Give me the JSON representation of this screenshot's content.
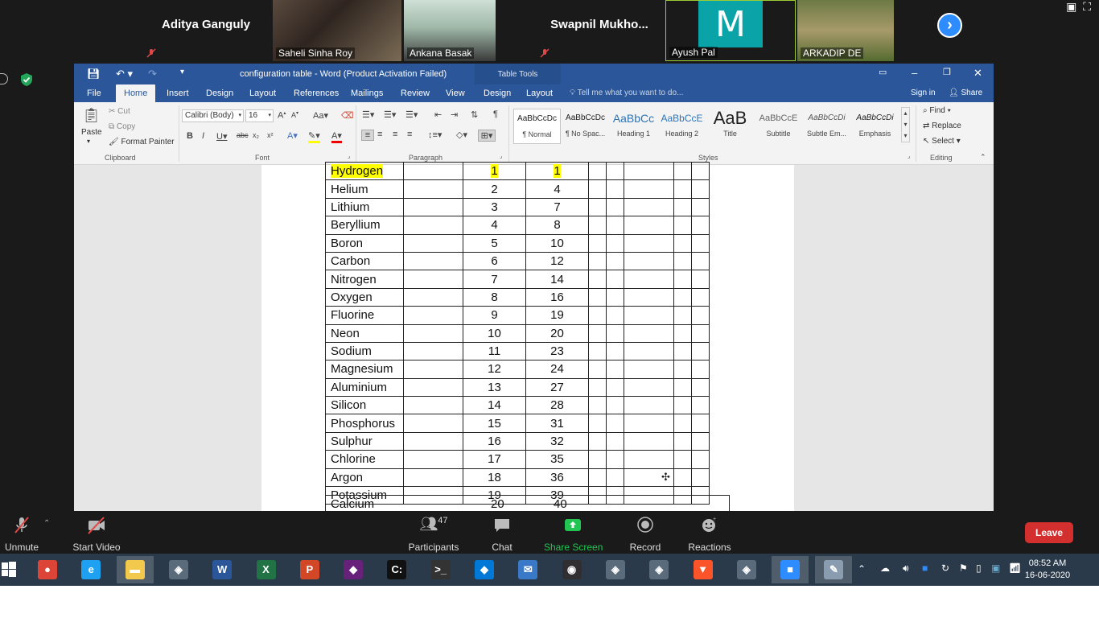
{
  "zoom": {
    "participants": [
      {
        "name": "Aditya Ganguly",
        "muted": true,
        "video": false
      },
      {
        "name": "Saheli Sinha Roy",
        "video": true
      },
      {
        "name": "Ankana Basak",
        "video": true
      },
      {
        "name": "Swapnil  Mukho...",
        "muted": true,
        "video": false
      },
      {
        "name": "Ayush Pal",
        "avatar_letter": "M",
        "video": false
      },
      {
        "name": "ARKADIP DE",
        "video": true
      }
    ],
    "controls": {
      "unmute": "Unmute",
      "start_video": "Start Video",
      "participants": "Participants",
      "participants_count": "47",
      "chat": "Chat",
      "share_screen": "Share Screen",
      "record": "Record",
      "reactions": "Reactions",
      "leave": "Leave"
    }
  },
  "word": {
    "title": "configuration table - Word (Product Activation Failed)",
    "context_tab_group": "Table Tools",
    "tabs": [
      "File",
      "Home",
      "Insert",
      "Design",
      "Layout",
      "References",
      "Mailings",
      "Review",
      "View",
      "Design",
      "Layout"
    ],
    "active_tab": "Home",
    "tell_me": "Tell me what you want to do...",
    "sign_in": "Sign in",
    "share": "Share",
    "ribbon": {
      "clipboard": {
        "paste": "Paste",
        "cut": "Cut",
        "copy": "Copy",
        "format_painter": "Format Painter",
        "label": "Clipboard"
      },
      "font": {
        "family": "Calibri (Body)",
        "size": "16",
        "label": "Font"
      },
      "paragraph": {
        "label": "Paragraph"
      },
      "styles": {
        "items": [
          {
            "preview": "AaBbCcDc",
            "name": "¶ Normal"
          },
          {
            "preview": "AaBbCcDc",
            "name": "¶ No Spac..."
          },
          {
            "preview": "AaBbCc",
            "name": "Heading 1"
          },
          {
            "preview": "AaBbCcE",
            "name": "Heading 2"
          },
          {
            "preview": "AaB",
            "name": "Title"
          },
          {
            "preview": "AaBbCcE",
            "name": "Subtitle"
          },
          {
            "preview": "AaBbCcDi",
            "name": "Subtle Em..."
          },
          {
            "preview": "AaBbCcDi",
            "name": "Emphasis"
          }
        ],
        "label": "Styles"
      },
      "editing": {
        "find": "Find",
        "replace": "Replace",
        "select": "Select",
        "label": "Editing"
      }
    },
    "table": {
      "rows": [
        {
          "name": "Hydrogen",
          "atomic_number": "1",
          "mass": "1"
        },
        {
          "name": "Helium",
          "atomic_number": "2",
          "mass": "4"
        },
        {
          "name": "Lithium",
          "atomic_number": "3",
          "mass": "7"
        },
        {
          "name": "Beryllium",
          "atomic_number": "4",
          "mass": "8"
        },
        {
          "name": "Boron",
          "atomic_number": "5",
          "mass": "10"
        },
        {
          "name": "Carbon",
          "atomic_number": "6",
          "mass": "12"
        },
        {
          "name": "Nitrogen",
          "atomic_number": "7",
          "mass": "14"
        },
        {
          "name": "Oxygen",
          "atomic_number": "8",
          "mass": "16"
        },
        {
          "name": "Fluorine",
          "atomic_number": "9",
          "mass": "19"
        },
        {
          "name": "Neon",
          "atomic_number": "10",
          "mass": "20"
        },
        {
          "name": "Sodium",
          "atomic_number": "11",
          "mass": "23"
        },
        {
          "name": "Magnesium",
          "atomic_number": "12",
          "mass": "24"
        },
        {
          "name": "Aluminium",
          "atomic_number": "13",
          "mass": "27"
        },
        {
          "name": "Silicon",
          "atomic_number": "14",
          "mass": "28"
        },
        {
          "name": "Phosphorus",
          "atomic_number": "15",
          "mass": "31"
        },
        {
          "name": "Sulphur",
          "atomic_number": "16",
          "mass": "32"
        },
        {
          "name": "Chlorine",
          "atomic_number": "17",
          "mass": "35"
        },
        {
          "name": "Argon",
          "atomic_number": "18",
          "mass": "36"
        },
        {
          "name": "Potassium",
          "atomic_number": "19",
          "mass": "39"
        }
      ],
      "last_row": {
        "name": "Calcium",
        "atomic_number": "20",
        "mass": "40"
      }
    }
  },
  "taskbar": {
    "time": "08:52 AM",
    "date": "16-06-2020",
    "apps": [
      "chrome",
      "internet-explorer",
      "file-explorer",
      "app",
      "word",
      "excel",
      "powerpoint",
      "visual-studio",
      "command-prompt",
      "terminal",
      "vs-code",
      "mail",
      "obs",
      "app",
      "app",
      "brave",
      "app",
      "zoom",
      "paint"
    ]
  },
  "colors": {
    "word_blue": "#2b579a",
    "zoom_blue": "#2d8cff",
    "leave_red": "#d32f2f",
    "highlight": "#ffff00"
  }
}
